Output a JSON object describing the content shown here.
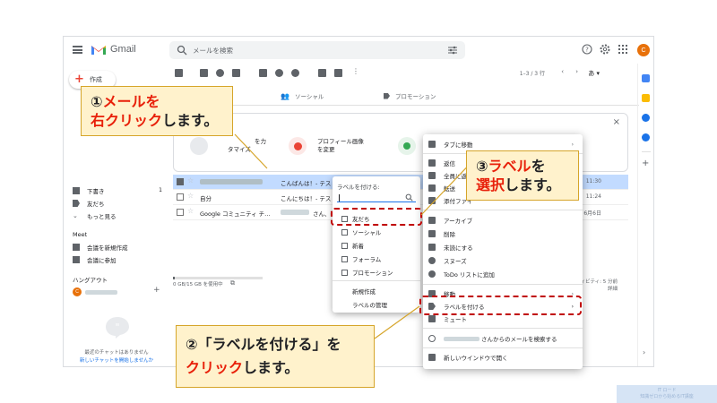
{
  "app": {
    "name": "Gmail"
  },
  "search": {
    "placeholder": "メールを検索"
  },
  "user": {
    "initial": "C"
  },
  "sidebar": {
    "compose_label": "作成",
    "items": [
      {
        "label": "下書き",
        "count": "1"
      },
      {
        "label": "友だち",
        "count": ""
      },
      {
        "label": "もっと見る",
        "count": ""
      }
    ],
    "meet_header": "Meet",
    "meet_items": [
      "会議を新規作成",
      "会議に参加"
    ],
    "hangout_header": "ハングアウト",
    "chat_empty": "最近のチャットはありません",
    "chat_link": "新しいチャットを開始しませんか"
  },
  "toolbar": {
    "pager": "1–3 / 3 行",
    "lang": "あ ▾"
  },
  "tabs": [
    {
      "label": "ソーシャル"
    },
    {
      "label": "プロモーション"
    }
  ],
  "promo_card": {
    "item_left_line1": "を力",
    "item_left_line2": "タマイズ",
    "item_right_line1": "プロフィール画像",
    "item_right_line2": "を変更",
    "close": "×"
  },
  "emails": [
    {
      "subject": "こんばんは！- テス",
      "time": "11:30"
    },
    {
      "sender": "自分",
      "subject": "こんにちは！- テス",
      "time": "11:24"
    },
    {
      "sender": "Google コミュニティ チ…",
      "subject": "さん、新し",
      "time": "6月6日"
    }
  ],
  "storage": {
    "text": "0 GB/15 GB を使用中",
    "fill_fraction": 0.02
  },
  "activity": {
    "line1": "ィビティ: 5 分前",
    "line2": "詳細"
  },
  "label_menu": {
    "title": "ラベルを付ける:",
    "labels": [
      "友だち",
      "ソーシャル",
      "新着",
      "フォーラム",
      "プロモーション"
    ],
    "create": "新規作成",
    "manage": "ラベルの管理"
  },
  "context_menu": {
    "items": [
      "タブに移動",
      "返信",
      "全員に返信",
      "転送",
      "添付ファイ",
      "アーカイブ",
      "削除",
      "未読にする",
      "スヌーズ",
      "ToDo リストに追加",
      "移動",
      "ラベルを付ける",
      "ミュート",
      "さんからのメールを検索する",
      "新しいウインドウで開く"
    ]
  },
  "callouts": {
    "c1_line1_num": "①",
    "c1_line1": "メールを",
    "c1_line2_red": "右クリック",
    "c1_line2": "します。",
    "c2_line1_num": "②",
    "c2_line1": "「ラベルを付ける」を",
    "c2_line2_red": "クリック",
    "c2_line2": "します。",
    "c3_line1_num": "③",
    "c3_line1_red": "ラベル",
    "c3_line1": "を",
    "c3_line2_red": "選択",
    "c3_line2": "します。"
  },
  "footer": {
    "line1": "IT ロード",
    "line2": "知識ゼロから始めるIT講座"
  },
  "colors": {
    "accent": "#1a73e8",
    "callout_bg": "#fff2cc",
    "callout_border": "#d6a52a",
    "red": "#e8200a",
    "dash": "#c00000",
    "selected_row": "#c2dbff"
  }
}
